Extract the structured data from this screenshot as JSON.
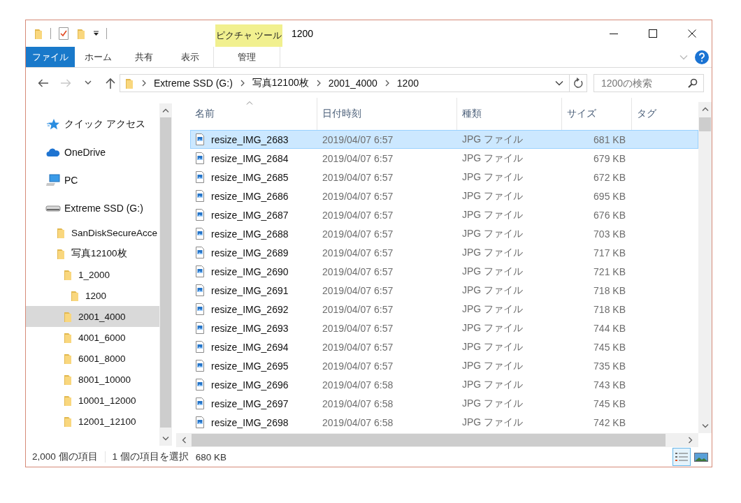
{
  "window": {
    "title": "1200",
    "context_tab_group": "ピクチャ ツール"
  },
  "ribbon_tabs": [
    {
      "label": "ファイル",
      "kind": "file"
    },
    {
      "label": "ホーム",
      "kind": "tab"
    },
    {
      "label": "共有",
      "kind": "tab"
    },
    {
      "label": "表示",
      "kind": "tab"
    },
    {
      "label": "管理",
      "kind": "context"
    }
  ],
  "nav_buttons": [
    {
      "kind": "back",
      "disabled": false
    },
    {
      "kind": "forward",
      "disabled": true
    },
    {
      "kind": "recent",
      "disabled": false
    },
    {
      "kind": "up",
      "disabled": false
    }
  ],
  "breadcrumb": [
    "Extreme SSD (G:)",
    "写真12100枚",
    "2001_4000",
    "1200"
  ],
  "search": {
    "placeholder": "1200の検索"
  },
  "sidebar": {
    "items": [
      {
        "label": "クイック アクセス",
        "kind": "quick",
        "selected": false
      },
      {
        "label": "OneDrive",
        "kind": "cloud",
        "selected": false
      },
      {
        "label": "PC",
        "kind": "pc",
        "selected": false
      },
      {
        "label": "Extreme SSD (G:)",
        "kind": "drive",
        "selected": false,
        "children": [
          {
            "label": "SanDiskSecureAcce",
            "kind": "folder",
            "selected": false
          },
          {
            "label": "写真12100枚",
            "kind": "folder",
            "selected": false,
            "children": [
              {
                "label": "1_2000",
                "kind": "folder",
                "selected": false,
                "children": [
                  {
                    "label": "1200",
                    "kind": "folder",
                    "selected": false
                  }
                ]
              },
              {
                "label": "2001_4000",
                "kind": "folder",
                "selected": true
              },
              {
                "label": "4001_6000",
                "kind": "folder",
                "selected": false
              },
              {
                "label": "6001_8000",
                "kind": "folder",
                "selected": false
              },
              {
                "label": "8001_10000",
                "kind": "folder",
                "selected": false
              },
              {
                "label": "10001_12000",
                "kind": "folder",
                "selected": false
              },
              {
                "label": "12001_12100",
                "kind": "folder",
                "selected": false
              }
            ]
          }
        ]
      }
    ]
  },
  "table": {
    "columns": [
      {
        "label": "名前",
        "sorted": true
      },
      {
        "label": "日付時刻",
        "sorted": false
      },
      {
        "label": "種類",
        "sorted": false
      },
      {
        "label": "サイズ",
        "sorted": false
      },
      {
        "label": "タグ",
        "sorted": false
      }
    ],
    "rows": [
      {
        "name": "resize_IMG_2683",
        "date": "2019/04/07 6:57",
        "type": "JPG ファイル",
        "size": "681 KB",
        "selected": true
      },
      {
        "name": "resize_IMG_2684",
        "date": "2019/04/07 6:57",
        "type": "JPG ファイル",
        "size": "679 KB",
        "selected": false
      },
      {
        "name": "resize_IMG_2685",
        "date": "2019/04/07 6:57",
        "type": "JPG ファイル",
        "size": "672 KB",
        "selected": false
      },
      {
        "name": "resize_IMG_2686",
        "date": "2019/04/07 6:57",
        "type": "JPG ファイル",
        "size": "695 KB",
        "selected": false
      },
      {
        "name": "resize_IMG_2687",
        "date": "2019/04/07 6:57",
        "type": "JPG ファイル",
        "size": "676 KB",
        "selected": false
      },
      {
        "name": "resize_IMG_2688",
        "date": "2019/04/07 6:57",
        "type": "JPG ファイル",
        "size": "703 KB",
        "selected": false
      },
      {
        "name": "resize_IMG_2689",
        "date": "2019/04/07 6:57",
        "type": "JPG ファイル",
        "size": "717 KB",
        "selected": false
      },
      {
        "name": "resize_IMG_2690",
        "date": "2019/04/07 6:57",
        "type": "JPG ファイル",
        "size": "721 KB",
        "selected": false
      },
      {
        "name": "resize_IMG_2691",
        "date": "2019/04/07 6:57",
        "type": "JPG ファイル",
        "size": "718 KB",
        "selected": false
      },
      {
        "name": "resize_IMG_2692",
        "date": "2019/04/07 6:57",
        "type": "JPG ファイル",
        "size": "718 KB",
        "selected": false
      },
      {
        "name": "resize_IMG_2693",
        "date": "2019/04/07 6:57",
        "type": "JPG ファイル",
        "size": "744 KB",
        "selected": false
      },
      {
        "name": "resize_IMG_2694",
        "date": "2019/04/07 6:57",
        "type": "JPG ファイル",
        "size": "745 KB",
        "selected": false
      },
      {
        "name": "resize_IMG_2695",
        "date": "2019/04/07 6:57",
        "type": "JPG ファイル",
        "size": "735 KB",
        "selected": false
      },
      {
        "name": "resize_IMG_2696",
        "date": "2019/04/07 6:58",
        "type": "JPG ファイル",
        "size": "743 KB",
        "selected": false
      },
      {
        "name": "resize_IMG_2697",
        "date": "2019/04/07 6:58",
        "type": "JPG ファイル",
        "size": "745 KB",
        "selected": false
      },
      {
        "name": "resize_IMG_2698",
        "date": "2019/04/07 6:58",
        "type": "JPG ファイル",
        "size": "742 KB",
        "selected": false
      }
    ]
  },
  "status_bar": {
    "item_count": "2,000 個の項目",
    "selection": "1 個の項目を選択",
    "selection_size": "680 KB",
    "views": [
      {
        "kind": "details",
        "selected": true
      },
      {
        "kind": "thumbnails",
        "selected": false
      }
    ]
  }
}
